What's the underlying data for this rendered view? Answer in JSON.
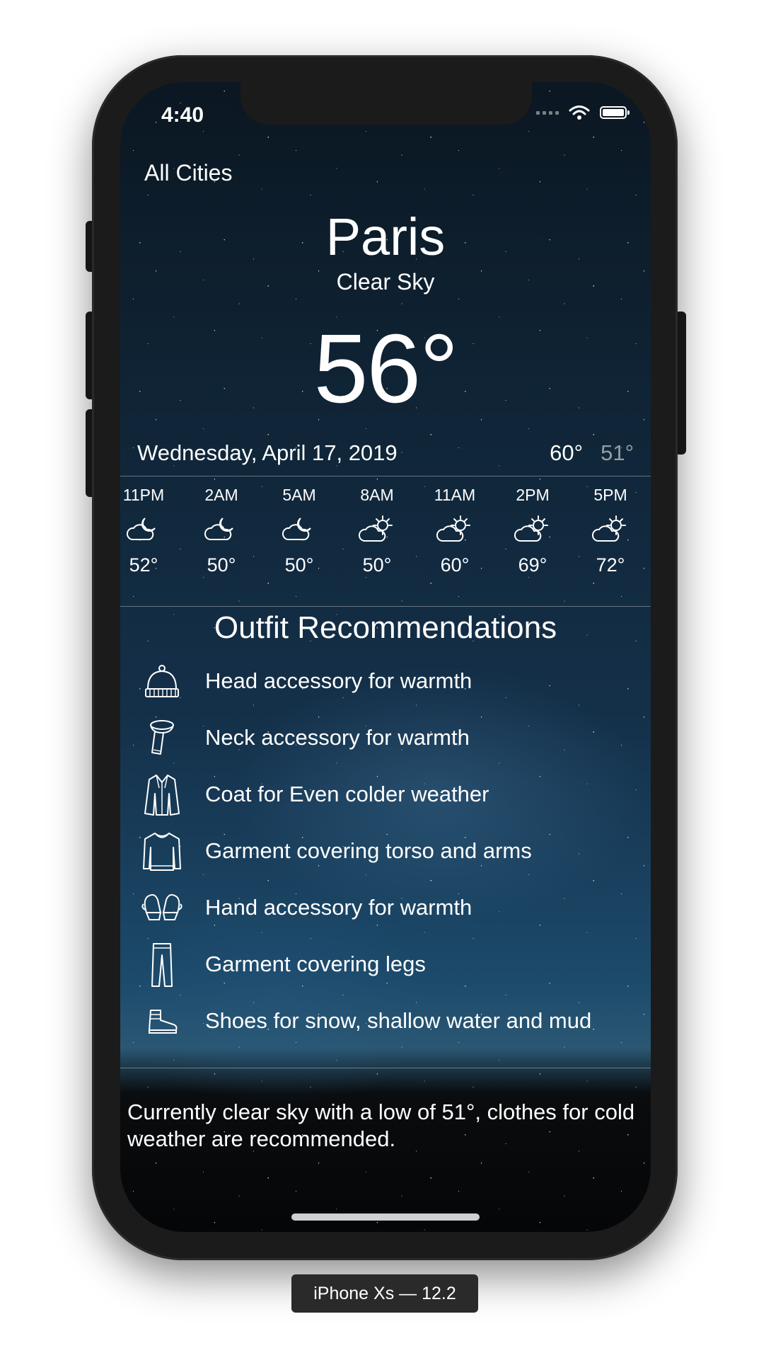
{
  "status_bar": {
    "time": "4:40"
  },
  "nav": {
    "all_cities": "All Cities"
  },
  "weather": {
    "city": "Paris",
    "condition": "Clear Sky",
    "current_temp": "56°",
    "date": "Wednesday, April 17, 2019",
    "high": "60°",
    "low": "51°"
  },
  "hourly": [
    {
      "time": "11PM",
      "temp": "52°",
      "icon": "moon-cloud-icon"
    },
    {
      "time": "2AM",
      "temp": "50°",
      "icon": "moon-cloud-icon"
    },
    {
      "time": "5AM",
      "temp": "50°",
      "icon": "moon-cloud-icon"
    },
    {
      "time": "8AM",
      "temp": "50°",
      "icon": "sun-cloud-icon"
    },
    {
      "time": "11AM",
      "temp": "60°",
      "icon": "sun-cloud-icon"
    },
    {
      "time": "2PM",
      "temp": "69°",
      "icon": "sun-cloud-icon"
    },
    {
      "time": "5PM",
      "temp": "72°",
      "icon": "sun-cloud-icon"
    }
  ],
  "outfit": {
    "title": "Outfit Recommendations",
    "items": [
      {
        "label": "Head accessory for warmth",
        "icon": "beanie-icon"
      },
      {
        "label": "Neck accessory for warmth",
        "icon": "scarf-icon"
      },
      {
        "label": "Coat for Even colder weather",
        "icon": "coat-icon"
      },
      {
        "label": "Garment covering torso and arms",
        "icon": "sweater-icon"
      },
      {
        "label": "Hand accessory for warmth",
        "icon": "mittens-icon"
      },
      {
        "label": "Garment covering legs",
        "icon": "pants-icon"
      },
      {
        "label": "Shoes for snow, shallow water and mud",
        "icon": "boot-icon"
      }
    ]
  },
  "summary": "Currently clear sky with a low of 51°, clothes for cold weather are recommended.",
  "device_label": "iPhone Xs — 12.2",
  "colors": {
    "sky_top": "#0b1722",
    "sky_bottom": "#1c4a6b",
    "text": "#ffffff",
    "low_temp": "#a6a6a6"
  }
}
